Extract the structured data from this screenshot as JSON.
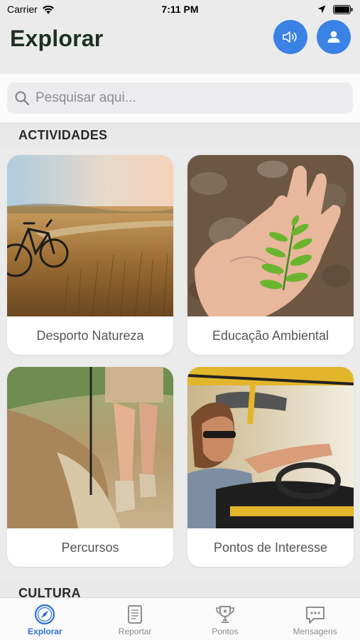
{
  "status": {
    "carrier": "Carrier",
    "time": "7:11 PM"
  },
  "header": {
    "title": "Explorar",
    "accent": "#3b82e6"
  },
  "search": {
    "placeholder": "Pesquisar aqui..."
  },
  "sections": [
    {
      "title": "ACTIVIDADES",
      "cards": [
        {
          "label": "Desporto Natureza",
          "image": "bicycle-field-photo"
        },
        {
          "label": "Educação Ambiental",
          "image": "leaf-in-hand-photo"
        },
        {
          "label": "Percursos",
          "image": "hiker-trail-photo"
        },
        {
          "label": "Pontos de Interesse",
          "image": "man-driving-jeep-photo"
        }
      ]
    },
    {
      "title": "CULTURA"
    }
  ],
  "tabbar": {
    "active_color": "#2f6fd6",
    "items": [
      {
        "label": "Explorar",
        "icon": "compass-icon"
      },
      {
        "label": "Reportar",
        "icon": "document-icon"
      },
      {
        "label": "Pontos",
        "icon": "trophy-icon"
      },
      {
        "label": "Mensagens",
        "icon": "chat-bubble-icon"
      }
    ]
  }
}
